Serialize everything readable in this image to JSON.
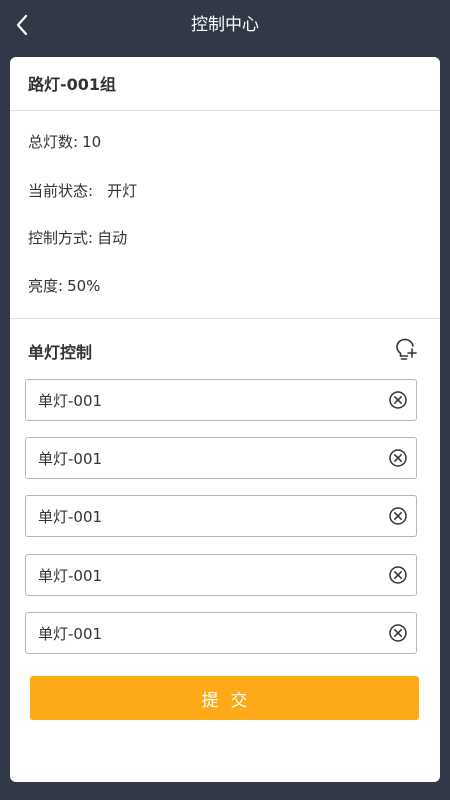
{
  "header": {
    "title": "控制中心"
  },
  "group": {
    "title": "路灯-001组"
  },
  "info": {
    "total_label": "总灯数:",
    "total_value": "10",
    "status_label": "当前状态:",
    "status_value": "开灯",
    "mode_label": "控制方式:",
    "mode_value": "自动",
    "brightness_label": "亮度:",
    "brightness_value": "50%"
  },
  "single_control": {
    "title": "单灯控制",
    "lamps": [
      {
        "value": "单灯-001"
      },
      {
        "value": "单灯-001"
      },
      {
        "value": "单灯-001"
      },
      {
        "value": "单灯-001"
      },
      {
        "value": "单灯-001"
      }
    ]
  },
  "submit_label": "提交",
  "colors": {
    "header_bg": "#313948",
    "accent": "#fea918",
    "text": "#333333"
  },
  "icons": {
    "back": "chevron-left-icon",
    "bulb": "lightbulb-plus-icon",
    "clear": "circle-x-icon"
  }
}
